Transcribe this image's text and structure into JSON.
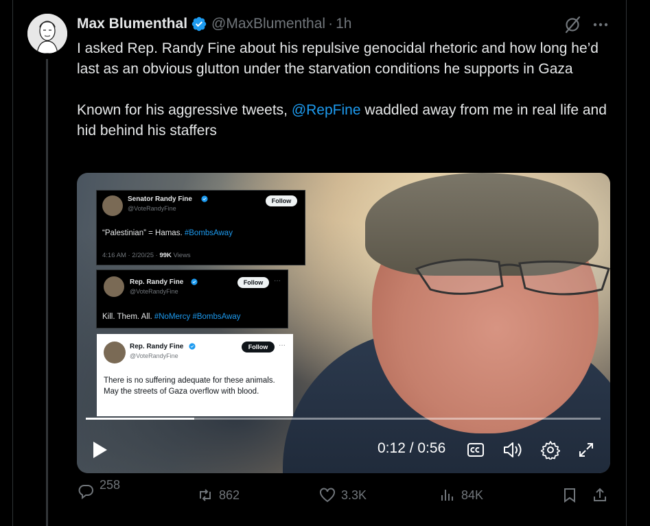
{
  "author": {
    "name": "Max Blumenthal",
    "handle": "@MaxBlumenthal",
    "separator": "·",
    "time": "1h"
  },
  "tweet": {
    "para1": "I asked Rep. Randy Fine about his repulsive genocidal rhetoric and how long he’d last as an obvious glutton under the starvation conditions he supports in Gaza",
    "para2_before": "Known for his aggressive tweets, ",
    "para2_mention": "@RepFine",
    "para2_after": " waddled away from me in real life and hid behind his staffers"
  },
  "embedded_tweets": [
    {
      "name": "Senator Randy Fine",
      "handle": "@VoteRandyFine",
      "follow": "Follow",
      "text": "“Palestinian” = Hamas.  ",
      "tag": "#BombsAway",
      "meta_time": "4:16 AM · 2/20/25 · ",
      "meta_views_count": "99K",
      "meta_views_label": " Views"
    },
    {
      "name": "Rep. Randy Fine",
      "handle": "@VoteRandyFine",
      "follow": "Follow",
      "ellipsis": "···",
      "text": "Kill.  Them.  All.  ",
      "tag": "#NoMercy #BombsAway"
    },
    {
      "name": "Rep. Randy Fine",
      "handle": "@VoteRandyFine",
      "follow": "Follow",
      "ellipsis": "···",
      "text": "There is no suffering adequate for these animals.  May the streets of Gaza overflow with blood."
    }
  ],
  "video": {
    "time_display": "0:12 / 0:56",
    "progress_fraction": 0.21
  },
  "actions": {
    "replies": "258",
    "reposts": "862",
    "likes": "3.3K",
    "views": "84K"
  },
  "colors": {
    "accent": "#1d9bf0",
    "muted": "#71767b",
    "text": "#e7e9ea"
  }
}
